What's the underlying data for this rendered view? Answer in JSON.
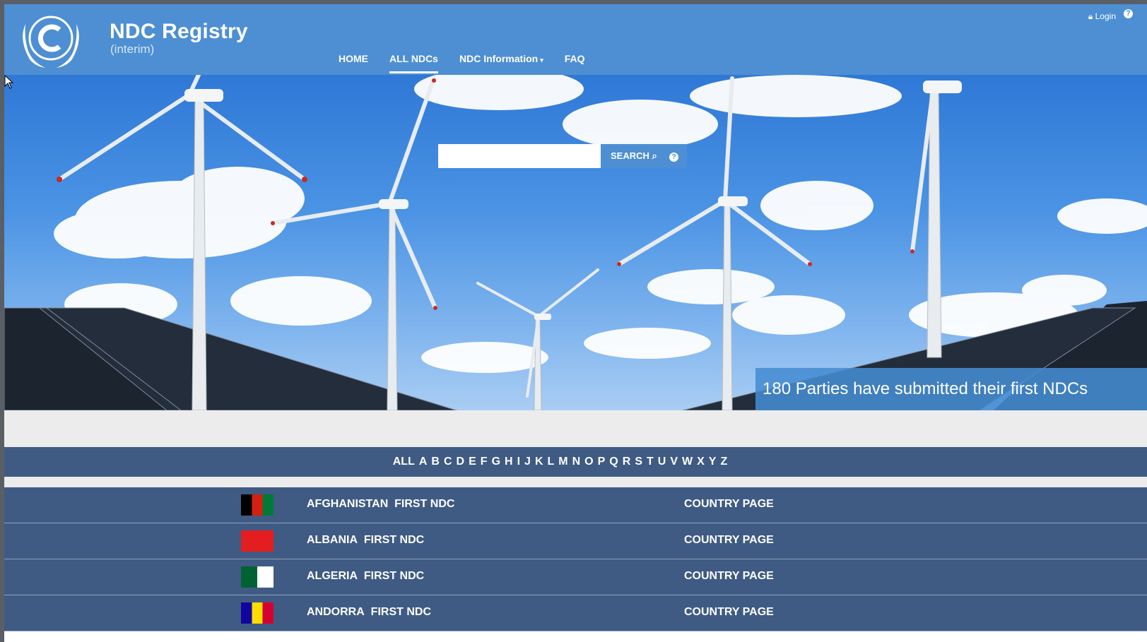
{
  "brand": {
    "title": "NDC Registry",
    "subtitle": "(interim)"
  },
  "nav": {
    "items": [
      {
        "label": "HOME",
        "active": false
      },
      {
        "label": "ALL NDCs",
        "active": true
      },
      {
        "label": "NDC Information",
        "active": false,
        "dropdown": true
      },
      {
        "label": "FAQ",
        "active": false
      }
    ]
  },
  "top": {
    "login_label": "Login",
    "help_glyph": "?"
  },
  "search": {
    "value": "",
    "placeholder": "",
    "button_label": "SEARCH",
    "help_glyph": "?"
  },
  "banner": {
    "text": "180 Parties have submitted their first NDCs"
  },
  "alphabet": [
    "ALL",
    "A",
    "B",
    "C",
    "D",
    "E",
    "F",
    "G",
    "H",
    "I",
    "J",
    "K",
    "L",
    "M",
    "N",
    "O",
    "P",
    "Q",
    "R",
    "S",
    "T",
    "U",
    "V",
    "W",
    "X",
    "Y",
    "Z"
  ],
  "countries": [
    {
      "name": "AFGHANISTAN",
      "ndc": "FIRST NDC",
      "link": "COUNTRY PAGE",
      "flag_colors": [
        "#000000",
        "#d32011",
        "#007a36"
      ]
    },
    {
      "name": "ALBANIA",
      "ndc": "FIRST NDC",
      "link": "COUNTRY PAGE",
      "flag_colors": [
        "#e41e20"
      ]
    },
    {
      "name": "ALGERIA",
      "ndc": "FIRST NDC",
      "link": "COUNTRY PAGE",
      "flag_colors": [
        "#006233",
        "#ffffff",
        "#d21034"
      ]
    },
    {
      "name": "ANDORRA",
      "ndc": "FIRST NDC",
      "link": "COUNTRY PAGE",
      "flag_colors": [
        "#10069f",
        "#fedd00",
        "#d50032"
      ]
    }
  ],
  "colors": {
    "header": "#4d8fd2",
    "list_bg": "#3f5b83",
    "gap_bg": "#ececec"
  }
}
